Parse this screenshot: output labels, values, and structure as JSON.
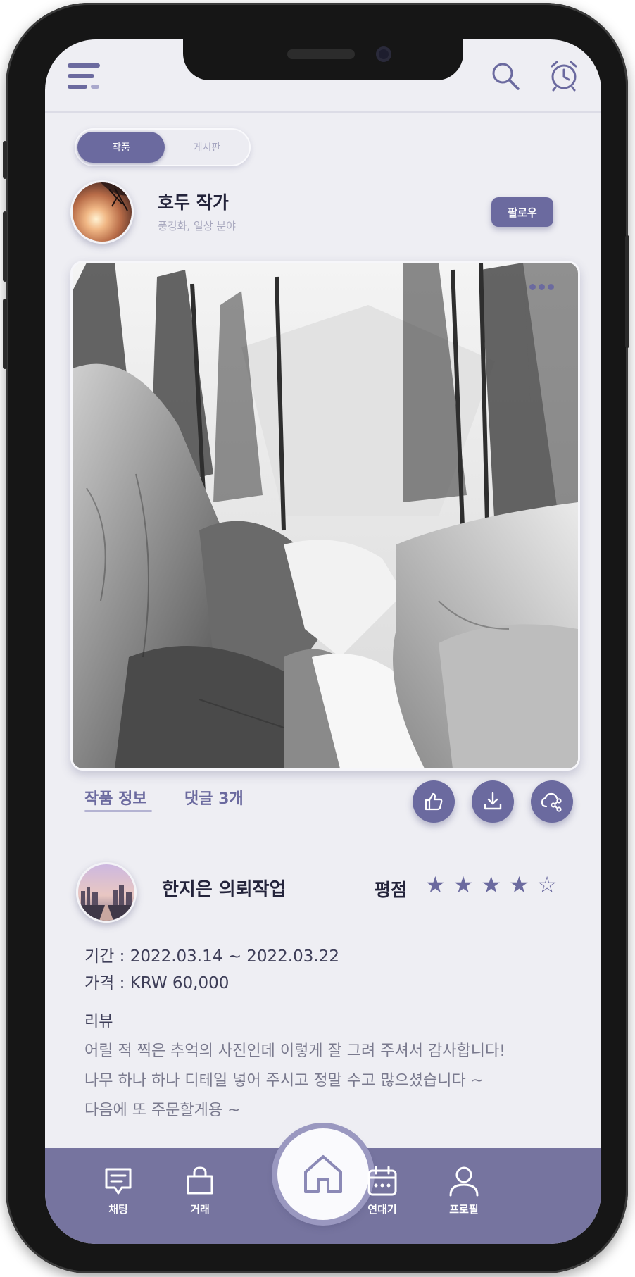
{
  "header": {
    "menu_icon": "menu-icon",
    "search_icon": "search-icon",
    "alarm_icon": "alarm-clock-icon"
  },
  "segment": {
    "active": "작품",
    "inactive": "게시판"
  },
  "author": {
    "name": "호두 작가",
    "subtitle": "풍경화, 일상 분야",
    "follow_label": "팔로우"
  },
  "artwork": {
    "more_icon": "more-dots-icon"
  },
  "tabs": {
    "info": "작품 정보",
    "comments": "댓글 3개"
  },
  "actions": {
    "like_icon": "thumbs-up-icon",
    "download_icon": "download-icon",
    "share_icon": "share-cloud-icon"
  },
  "review": {
    "reviewer": "한지은 의뢰작업",
    "rating_label": "평점",
    "rating": 4,
    "rating_max": 5,
    "period": "기간 : 2022.03.14 ~ 2022.03.22",
    "price": "가격 : KRW 60,000",
    "label": "리뷰",
    "lines": [
      "어릴 적 찍은 추억의 사진인데 이렇게 잘 그려 주셔서 감사합니다!",
      "나무 하나 하나 디테일 넣어 주시고 정말 수고 많으셨습니다 ~",
      "다음에 또 주문할게용 ~"
    ]
  },
  "nav": {
    "chat": "채팅",
    "trade": "거래",
    "home_icon": "home-icon",
    "calendar": "연대기",
    "profile": "프로필"
  },
  "colors": {
    "accent": "#6b6a9f",
    "navbar": "#76749f",
    "background": "#eeeef3"
  }
}
